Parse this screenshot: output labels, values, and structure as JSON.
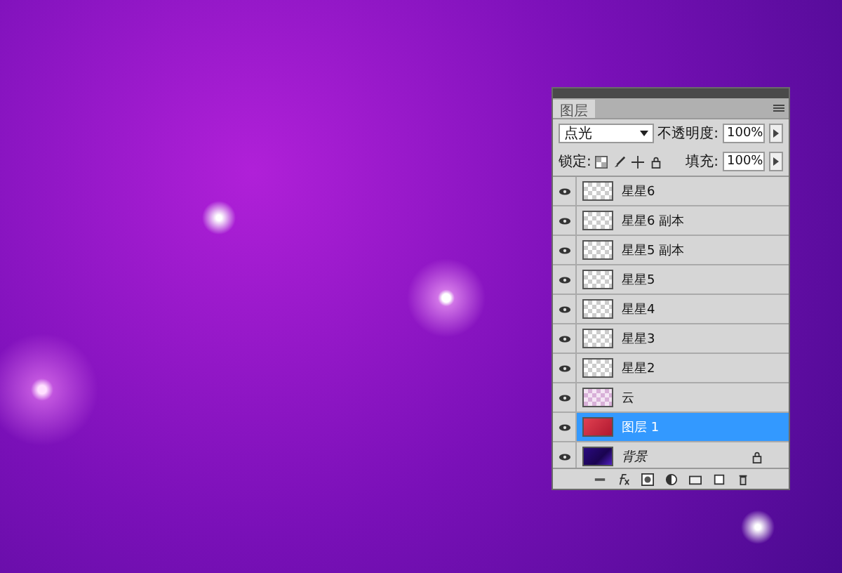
{
  "panel": {
    "tab": "图层",
    "blend_mode": "点光",
    "opacity_label": "不透明度:",
    "opacity": "100%",
    "lock_label": "锁定:",
    "fill_label": "填充:",
    "fill": "100%"
  },
  "layers": [
    {
      "name": "星星6",
      "kind": "transparent",
      "visible": true,
      "selected": false,
      "locked": false
    },
    {
      "name": "星星6 副本",
      "kind": "transparent",
      "visible": true,
      "selected": false,
      "locked": false
    },
    {
      "name": "星星5 副本",
      "kind": "transparent",
      "visible": true,
      "selected": false,
      "locked": false
    },
    {
      "name": "星星5",
      "kind": "transparent",
      "visible": true,
      "selected": false,
      "locked": false
    },
    {
      "name": "星星4",
      "kind": "transparent",
      "visible": true,
      "selected": false,
      "locked": false
    },
    {
      "name": "星星3",
      "kind": "transparent",
      "visible": true,
      "selected": false,
      "locked": false
    },
    {
      "name": "星星2",
      "kind": "transparent",
      "visible": true,
      "selected": false,
      "locked": false
    },
    {
      "name": "云",
      "kind": "cloud",
      "visible": true,
      "selected": false,
      "locked": false
    },
    {
      "name": "图层 1",
      "kind": "red",
      "visible": true,
      "selected": true,
      "locked": false
    },
    {
      "name": "背景",
      "kind": "night",
      "visible": true,
      "selected": false,
      "locked": true
    }
  ]
}
